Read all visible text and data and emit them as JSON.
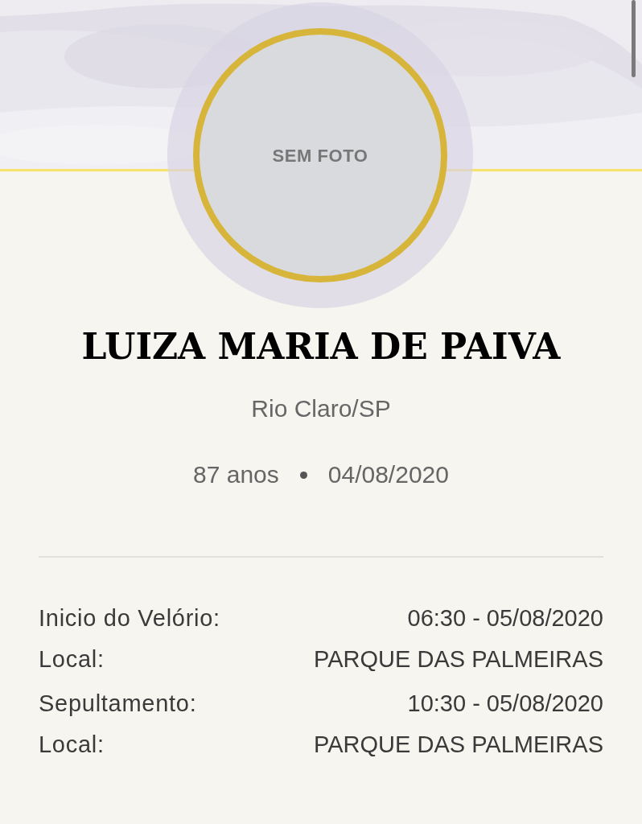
{
  "avatar": {
    "placeholder_text": "SEM FOTO"
  },
  "person": {
    "name": "LUIZA MARIA DE PAIVA",
    "location": "Rio Claro/SP",
    "age": "87 anos",
    "date": "04/08/2020"
  },
  "events": [
    {
      "label": "Inicio do Velório:",
      "value": "06:30 - 05/08/2020",
      "place_label": "Local:",
      "place": "PARQUE DAS PALMEIRAS"
    },
    {
      "label": "Sepultamento:",
      "value": "10:30 - 05/08/2020",
      "place_label": "Local:",
      "place": "PARQUE DAS PALMEIRAS"
    }
  ]
}
